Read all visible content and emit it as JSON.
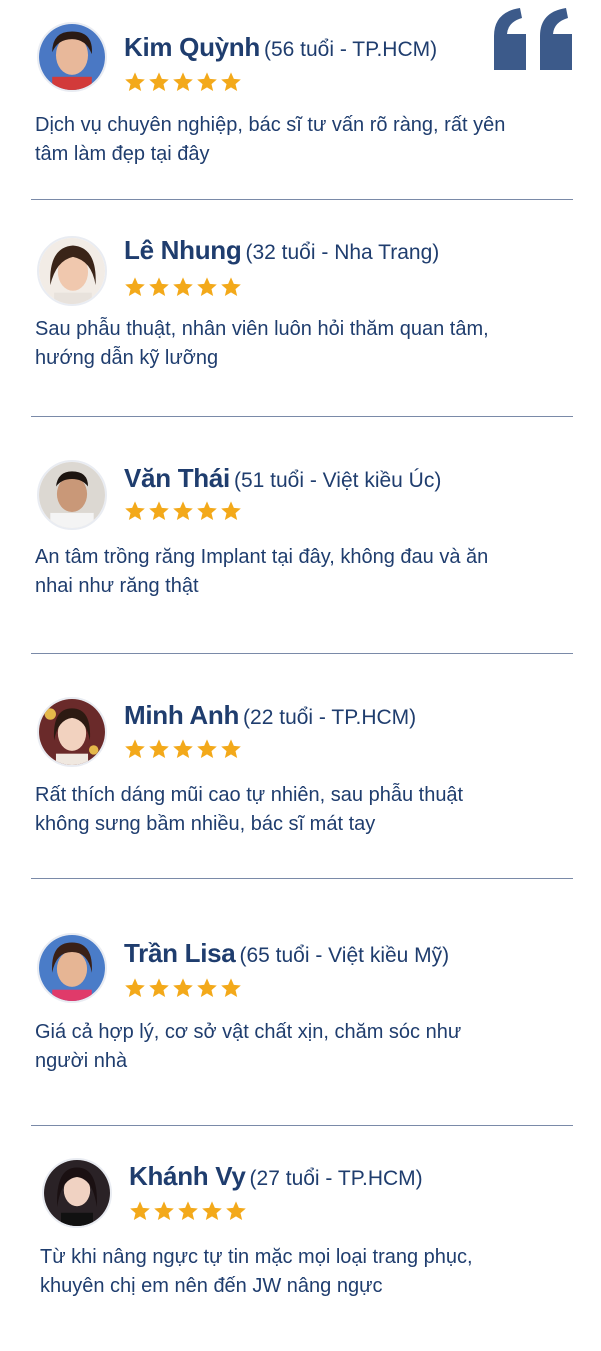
{
  "colors": {
    "name": "#1f3d6e",
    "star": "#f3a91a",
    "quote": "#3c5a8a",
    "divider": "#7a8aa8"
  },
  "quote_icon": "quote-mark-icon",
  "reviews": [
    {
      "name": "Kim Quỳnh",
      "meta": "(56 tuổi - TP.HCM)",
      "rating": 5,
      "comment_line1": "Dịch vụ chuyên nghiệp, bác sĩ tư vấn rõ ràng, rất yên",
      "comment_line2": "tâm làm đẹp tại đây"
    },
    {
      "name": "Lê Nhung",
      "meta": "(32 tuổi - Nha Trang)",
      "rating": 5,
      "comment_line1": "Sau phẫu thuật, nhân viên luôn hỏi thăm quan tâm,",
      "comment_line2": "hướng dẫn kỹ lưỡng"
    },
    {
      "name": "Văn Thái",
      "meta": "(51 tuổi - Việt kiều Úc)",
      "rating": 5,
      "comment_line1": "An tâm trồng răng Implant tại đây, không đau và ăn",
      "comment_line2": "nhai như răng thật"
    },
    {
      "name": "Minh Anh",
      "meta": "(22 tuổi - TP.HCM)",
      "rating": 5,
      "comment_line1": "Rất thích dáng mũi cao tự nhiên, sau phẫu thuật",
      "comment_line2": "không sưng bầm nhiều, bác sĩ mát tay"
    },
    {
      "name": "Trần Lisa",
      "meta": "(65 tuổi - Việt kiều Mỹ)",
      "rating": 5,
      "comment_line1": "Giá cả hợp lý, cơ sở vật chất xịn, chăm sóc như",
      "comment_line2": "người nhà"
    },
    {
      "name": "Khánh Vy",
      "meta": "(27 tuổi - TP.HCM)",
      "rating": 5,
      "comment_line1": "Từ khi nâng ngực tự tin mặc mọi loại trang phục,",
      "comment_line2": "khuyên chị em nên đến JW nâng ngực"
    }
  ]
}
